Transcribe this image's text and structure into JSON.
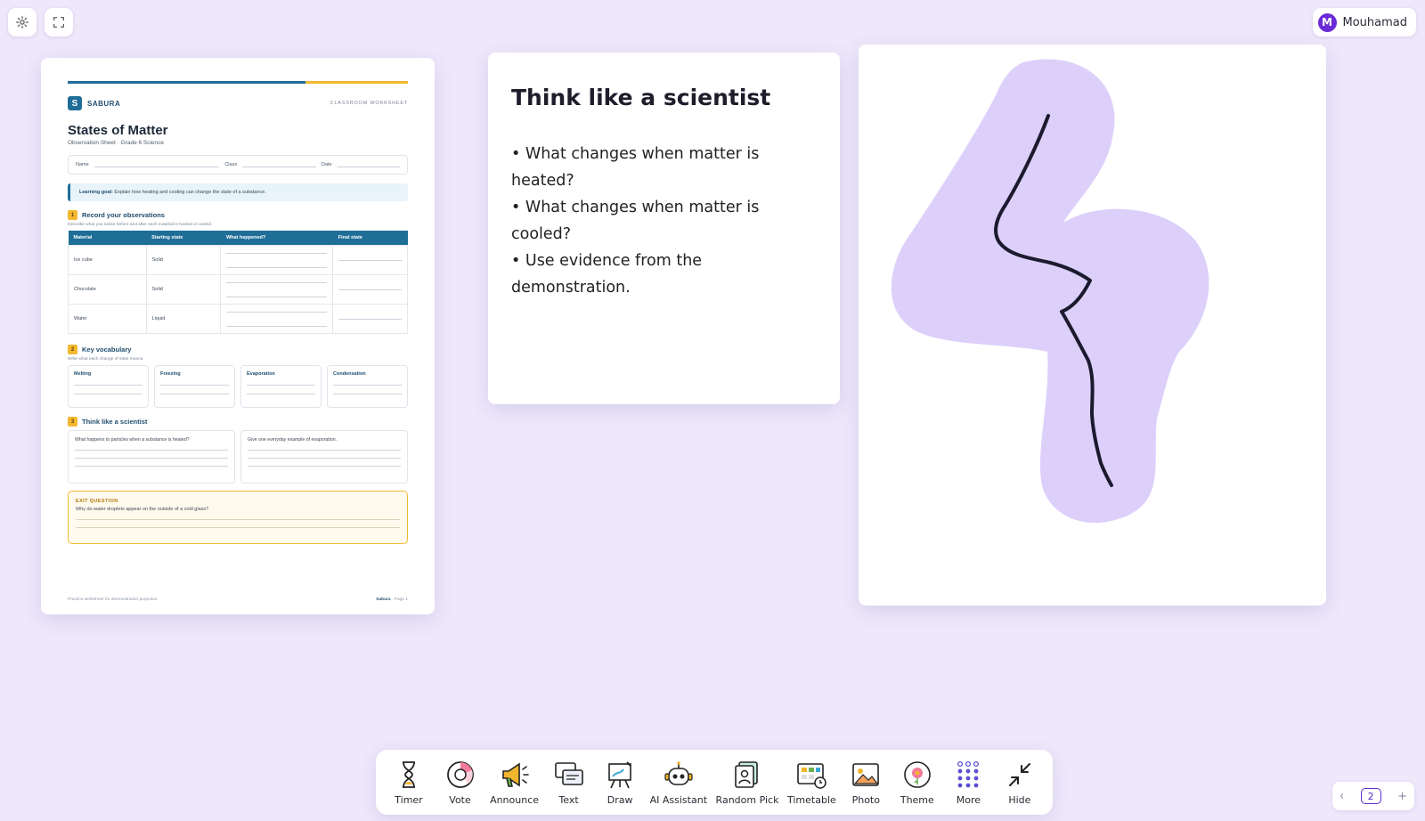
{
  "user": {
    "initial": "M",
    "name": "Mouhamad"
  },
  "worksheet": {
    "brand_initial": "S",
    "brand": "SABURA",
    "tag": "CLASSROOM WORKSHEET",
    "title": "States of Matter",
    "subtitle": "Observation Sheet · Grade 6 Science",
    "fields": {
      "name": "Name",
      "class": "Class",
      "date": "Date"
    },
    "goal_label": "Learning goal:",
    "goal_text": "Explain how heating and cooling can change the state of a substance.",
    "section1": {
      "num": "1",
      "title": "Record your observations",
      "hint": "Describe what you notice before and after each material is heated or cooled."
    },
    "table_headers": [
      "Material",
      "Starting state",
      "What happened?",
      "Final state"
    ],
    "rows": [
      {
        "material": "Ice cube",
        "state": "Solid"
      },
      {
        "material": "Chocolate",
        "state": "Solid"
      },
      {
        "material": "Water",
        "state": "Liquid"
      }
    ],
    "section2": {
      "num": "2",
      "title": "Key vocabulary",
      "hint": "Write what each change of state means."
    },
    "vocab": [
      "Melting",
      "Freezing",
      "Evaporation",
      "Condensation"
    ],
    "section3": {
      "num": "3",
      "title": "Think like a scientist"
    },
    "questions": [
      "What happens to particles when a substance is heated?",
      "Give one everyday example of evaporation."
    ],
    "exit_title": "EXIT QUESTION",
    "exit_question": "Why do water droplets appear on the outside of a cold glass?",
    "footer_left": "Practice worksheet for demonstration purposes.",
    "footer_brand": "Sabura",
    "footer_page": " · Page 1"
  },
  "text_card": {
    "title": "Think like a scientist",
    "bullets": [
      "• What changes when matter is heated?",
      "• What changes when matter is cooled?",
      "• Use evidence from the demonstration."
    ]
  },
  "toolbar": {
    "items": [
      {
        "label": "Timer",
        "icon": "hourglass-icon"
      },
      {
        "label": "Vote",
        "icon": "pie-icon"
      },
      {
        "label": "Announce",
        "icon": "megaphone-icon"
      },
      {
        "label": "Text",
        "icon": "text-bubble-icon"
      },
      {
        "label": "Draw",
        "icon": "easel-icon"
      },
      {
        "label": "AI Assistant",
        "icon": "robot-icon"
      },
      {
        "label": "Random Pick",
        "icon": "cards-icon"
      },
      {
        "label": "Timetable",
        "icon": "timetable-icon"
      },
      {
        "label": "Photo",
        "icon": "photo-icon"
      },
      {
        "label": "Theme",
        "icon": "theme-icon"
      },
      {
        "label": "More",
        "icon": "dots-grid-icon"
      },
      {
        "label": "Hide",
        "icon": "collapse-icon"
      }
    ]
  },
  "page_nav": {
    "prev": "‹",
    "current": "2",
    "add": "+"
  },
  "colors": {
    "background": "#efe8fb",
    "accent": "#5b2ec9",
    "blob": "#dcd0fb"
  }
}
